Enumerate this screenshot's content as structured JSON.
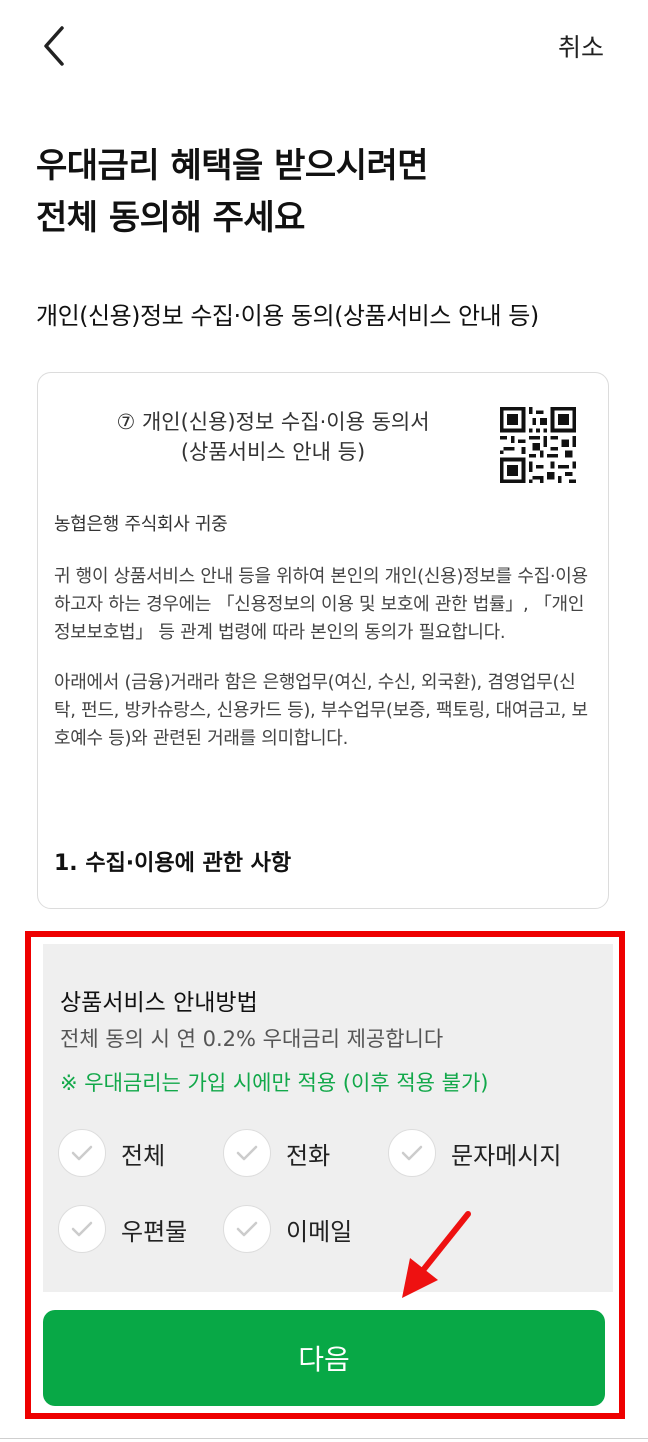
{
  "header": {
    "cancel_label": "취소"
  },
  "headline": {
    "line1": "우대금리 혜택을 받으시려면",
    "line2": "전체 동의해 주세요"
  },
  "section_title": "개인(신용)정보 수집·이용 동의(상품서비스 안내 등)",
  "document": {
    "title_line1": "⑦ 개인(신용)정보 수집·이용 동의서",
    "title_line2": "(상품서비스 안내 등)",
    "addressee": "농협은행 주식회사 귀중",
    "paragraph1": "귀 행이 상품서비스 안내 등을 위하여 본인의 개인(신용)정보를 수집·이용하고자 하는 경우에는 「신용정보의 이용 및 보호에 관한 법률」, 「개인정보보호법」 등 관계 법령에 따라 본인의 동의가 필요합니다.",
    "paragraph2": "아래에서 (금융)거래라 함은 은행업무(여신, 수신, 외국환), 겸영업무(신탁, 펀드, 방카슈랑스, 신용카드 등), 부수업무(보증, 팩토링, 대여금고, 보호예수 등)와 관련된 거래를 의미합니다.",
    "subheading": "1. 수집·이용에 관한 사항"
  },
  "notice": {
    "title": "상품서비스 안내방법",
    "subtitle": "전체 동의 시 연 0.2% 우대금리 제공합니다",
    "note": "※ 우대금리는 가입 시에만 적용 (이후 적용 불가)"
  },
  "options": [
    {
      "label": "전체",
      "checked": false
    },
    {
      "label": "전화",
      "checked": false
    },
    {
      "label": "문자메시지",
      "checked": false
    },
    {
      "label": "우편물",
      "checked": false
    },
    {
      "label": "이메일",
      "checked": false
    }
  ],
  "next_button_label": "다음",
  "colors": {
    "accent_green": "#08a846",
    "note_green": "#12a84a",
    "highlight_red": "#ee0000"
  },
  "icons": {
    "back": "chevron-left-icon",
    "check": "check-icon",
    "annotation": "arrow-icon",
    "qr": "qr-code-icon"
  }
}
